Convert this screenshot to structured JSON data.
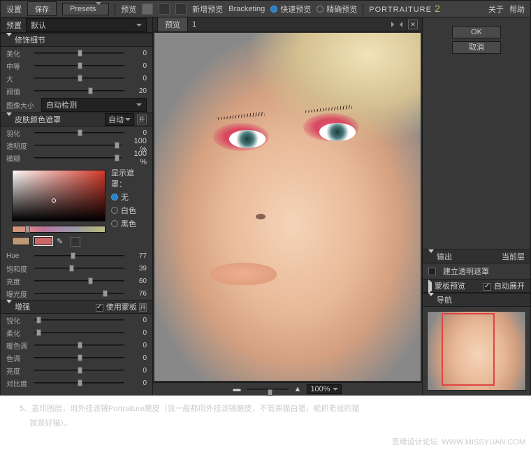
{
  "top": {
    "settings": "设置",
    "save": "保存",
    "presets": "Presets",
    "preview": "预览",
    "newpreview": "新增预览",
    "bracketing": "Bracketing",
    "fast": "快速预览",
    "precise": "精确预览",
    "brand": "PORTRAITURE",
    "brand_num": "2",
    "about": "关于",
    "help": "帮助"
  },
  "left": {
    "preset": "预置",
    "preset_val": "默认",
    "detail_hdr": "修饰细节",
    "s_fine": "美化",
    "v_fine": "0",
    "s_med": "中等",
    "v_med": "0",
    "s_large": "大",
    "v_large": "0",
    "s_thresh": "阀值",
    "v_thresh": "20",
    "imgsize": "图像大小",
    "imgsize_val": "自动检测",
    "mask_hdr": "皮肤颜色遮罩",
    "mask_auto": "自动",
    "open": "开",
    "s_feather": "羽化",
    "v_feather": "0",
    "s_opacity": "透明度",
    "v_opacity": "100",
    "pct": "%",
    "s_blur": "模糊",
    "v_blur": "100",
    "showmask": "显示遮罩：",
    "r_none": "无",
    "r_white": "白色",
    "r_black": "黑色",
    "s_hue": "Hue",
    "v_hue": "77",
    "s_sat": "饱和度",
    "v_sat": "39",
    "s_lum": "亮度",
    "v_lum": "60",
    "s_lat": "曝光度",
    "v_lat": "76",
    "enh_hdr": "增强",
    "use_skin": "使用蒙板",
    "s_sharp": "锐化",
    "v_sharp": "0",
    "s_soft": "柔化",
    "v_soft": "0",
    "s_warm": "暖色调",
    "v_warm": "0",
    "s_tint": "色调",
    "v_tint": "0",
    "s_bright": "亮度",
    "v_bright": "0",
    "s_contrast": "对比度",
    "v_contrast": "0"
  },
  "mid": {
    "tab": "预览",
    "tab_num": "1",
    "zoom": "100%"
  },
  "right": {
    "ok": "OK",
    "cancel": "取消",
    "output_hdr": "输出",
    "layer": "当前层",
    "newmask": "建立透明遮罩",
    "skin_pv": "蒙板预览",
    "autoexp": "自动展开",
    "nav": "导航"
  },
  "caption": {
    "num": "5、",
    "text1": "盖印图层，用外挂滤镜Portraiture磨皮（我一般都用外挂滤镜磨皮，不管黑猫白猫，能抓老鼠的猫",
    "text2": "就是好猫）。",
    "wm1": "思缘设计论坛",
    "wm2": "WWW.MISSYUAN.COM"
  }
}
